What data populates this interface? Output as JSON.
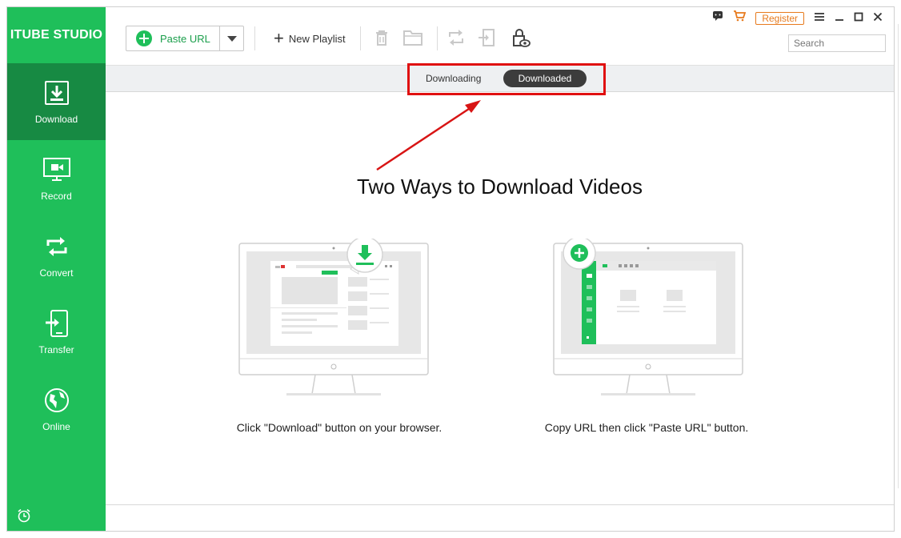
{
  "app": {
    "brand": "ITUBE STUDIO"
  },
  "sidebar": {
    "items": [
      {
        "label": "Download",
        "icon": "download-icon",
        "active": true
      },
      {
        "label": "Record",
        "icon": "record-icon",
        "active": false
      },
      {
        "label": "Convert",
        "icon": "convert-icon",
        "active": false
      },
      {
        "label": "Transfer",
        "icon": "transfer-icon",
        "active": false
      },
      {
        "label": "Online",
        "icon": "online-icon",
        "active": false
      }
    ]
  },
  "toolbar": {
    "paste_url": "Paste URL",
    "new_playlist": "New Playlist",
    "register": "Register",
    "search_placeholder": "Search"
  },
  "tabs": {
    "downloading": "Downloading",
    "downloaded": "Downloaded",
    "selected": "Downloaded"
  },
  "main": {
    "headline": "Two Ways to Download Videos",
    "ways": [
      {
        "caption": "Click \"Download\" button on your browser."
      },
      {
        "caption": "Copy URL then click \"Paste URL\" button."
      }
    ]
  },
  "colors": {
    "sidebar": "#1fbf5a",
    "sidebar_active": "#178a43",
    "accent": "#1fbf5a",
    "highlight": "#e01010",
    "register": "#e77a1d"
  }
}
